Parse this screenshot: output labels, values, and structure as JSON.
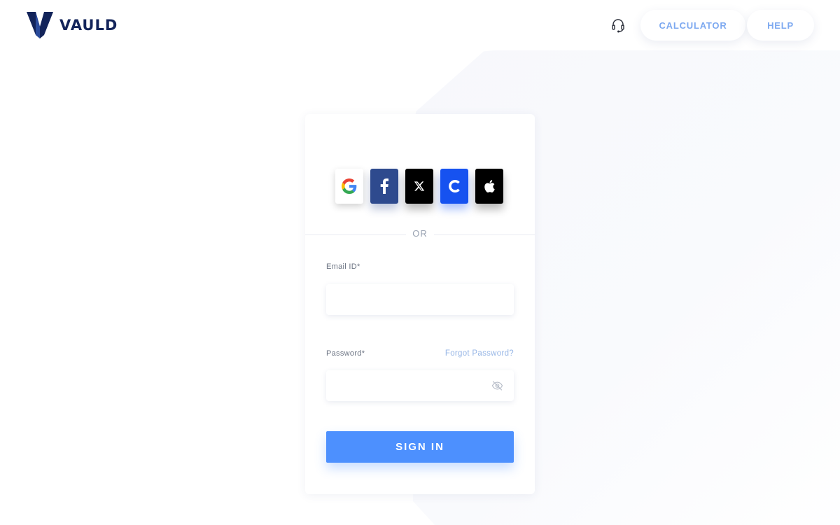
{
  "brand": {
    "name": "VAULD",
    "color": "#13245a"
  },
  "header": {
    "support_icon": "headset-icon",
    "nav": [
      {
        "label": "CALCULATOR"
      },
      {
        "label": "HELP"
      }
    ]
  },
  "login": {
    "social_buttons": [
      {
        "provider": "google",
        "icon": "google-icon"
      },
      {
        "provider": "facebook",
        "icon": "facebook-icon",
        "color": "#2e4a8e"
      },
      {
        "provider": "x",
        "icon": "x-icon",
        "color": "#000000"
      },
      {
        "provider": "coinbase",
        "icon": "coinbase-icon",
        "color": "#1652f0"
      },
      {
        "provider": "apple",
        "icon": "apple-icon",
        "color": "#000000"
      }
    ],
    "divider_text": "OR",
    "email": {
      "label": "Email ID*",
      "value": "",
      "placeholder": ""
    },
    "password": {
      "label": "Password*",
      "value": "",
      "placeholder": "",
      "toggle_icon": "eye-off-icon"
    },
    "forgot_password": "Forgot Password?",
    "submit_label": "SIGN IN",
    "accent_color": "#4d90fe"
  }
}
